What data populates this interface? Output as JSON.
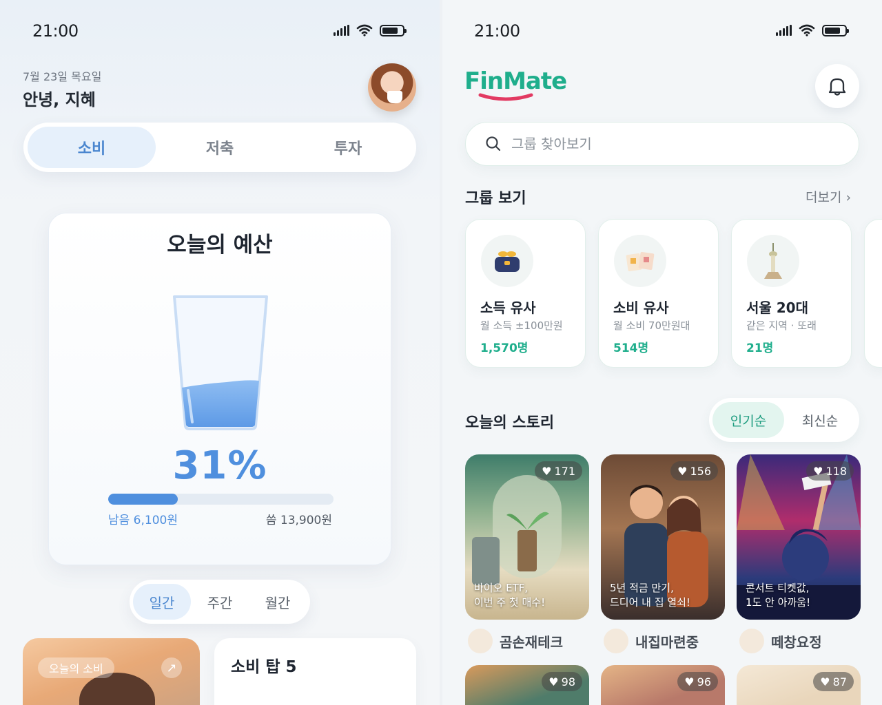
{
  "left": {
    "status": {
      "time": "21:00"
    },
    "header": {
      "date": "7월 23일 목요일",
      "greeting": "안녕, 지혜"
    },
    "tabs": [
      {
        "label": "소비",
        "active": true
      },
      {
        "label": "저축",
        "active": false
      },
      {
        "label": "투자",
        "active": false
      }
    ],
    "budget": {
      "title": "오늘의 예산",
      "percent_label": "31%",
      "progress": 0.31,
      "remaining": "남음 6,100원",
      "spent": "씀 13,900원"
    },
    "period": [
      {
        "label": "일간",
        "active": true
      },
      {
        "label": "주간",
        "active": false
      },
      {
        "label": "월간",
        "active": false
      }
    ],
    "today_card": {
      "label": "오늘의 소비",
      "icon": "arrow-up-right-icon"
    },
    "top5": {
      "title": "소비 탑 5"
    }
  },
  "right": {
    "status": {
      "time": "21:00"
    },
    "brand": {
      "name": "FinMate",
      "color": "#1fae8c"
    },
    "search": {
      "placeholder": "그룹 찾아보기"
    },
    "groups_section": {
      "title": "그룹 보기",
      "more": "더보기"
    },
    "groups": [
      {
        "name": "소득 유사",
        "desc": "월 소득 ±100만원",
        "count": "1,570명",
        "icon": "money-bag-icon"
      },
      {
        "name": "소비 유사",
        "desc": "월 소비 70만원대",
        "count": "514명",
        "icon": "receipt-icon"
      },
      {
        "name": "서울 20대",
        "desc": "같은 지역 · 또래",
        "count": "21명",
        "icon": "seoul-tower-icon"
      }
    ],
    "stories_section": {
      "title": "오늘의 스토리"
    },
    "sort": [
      {
        "label": "인기순",
        "active": true
      },
      {
        "label": "최신순",
        "active": false
      }
    ],
    "stories": [
      {
        "likes": "171",
        "caption": "바이오 ETF,\n이번 주 첫 매수!",
        "author": "곰손재테크"
      },
      {
        "likes": "156",
        "caption": "5년 적금 만기,\n드디어 내 집 열쇠!",
        "author": "내집마련중"
      },
      {
        "likes": "118",
        "caption": "콘서트 티켓값,\n1도 안 아까움!",
        "author": "떼창요정"
      }
    ],
    "stories_row2": [
      {
        "likes": "98"
      },
      {
        "likes": "96"
      },
      {
        "likes": "87"
      }
    ]
  }
}
